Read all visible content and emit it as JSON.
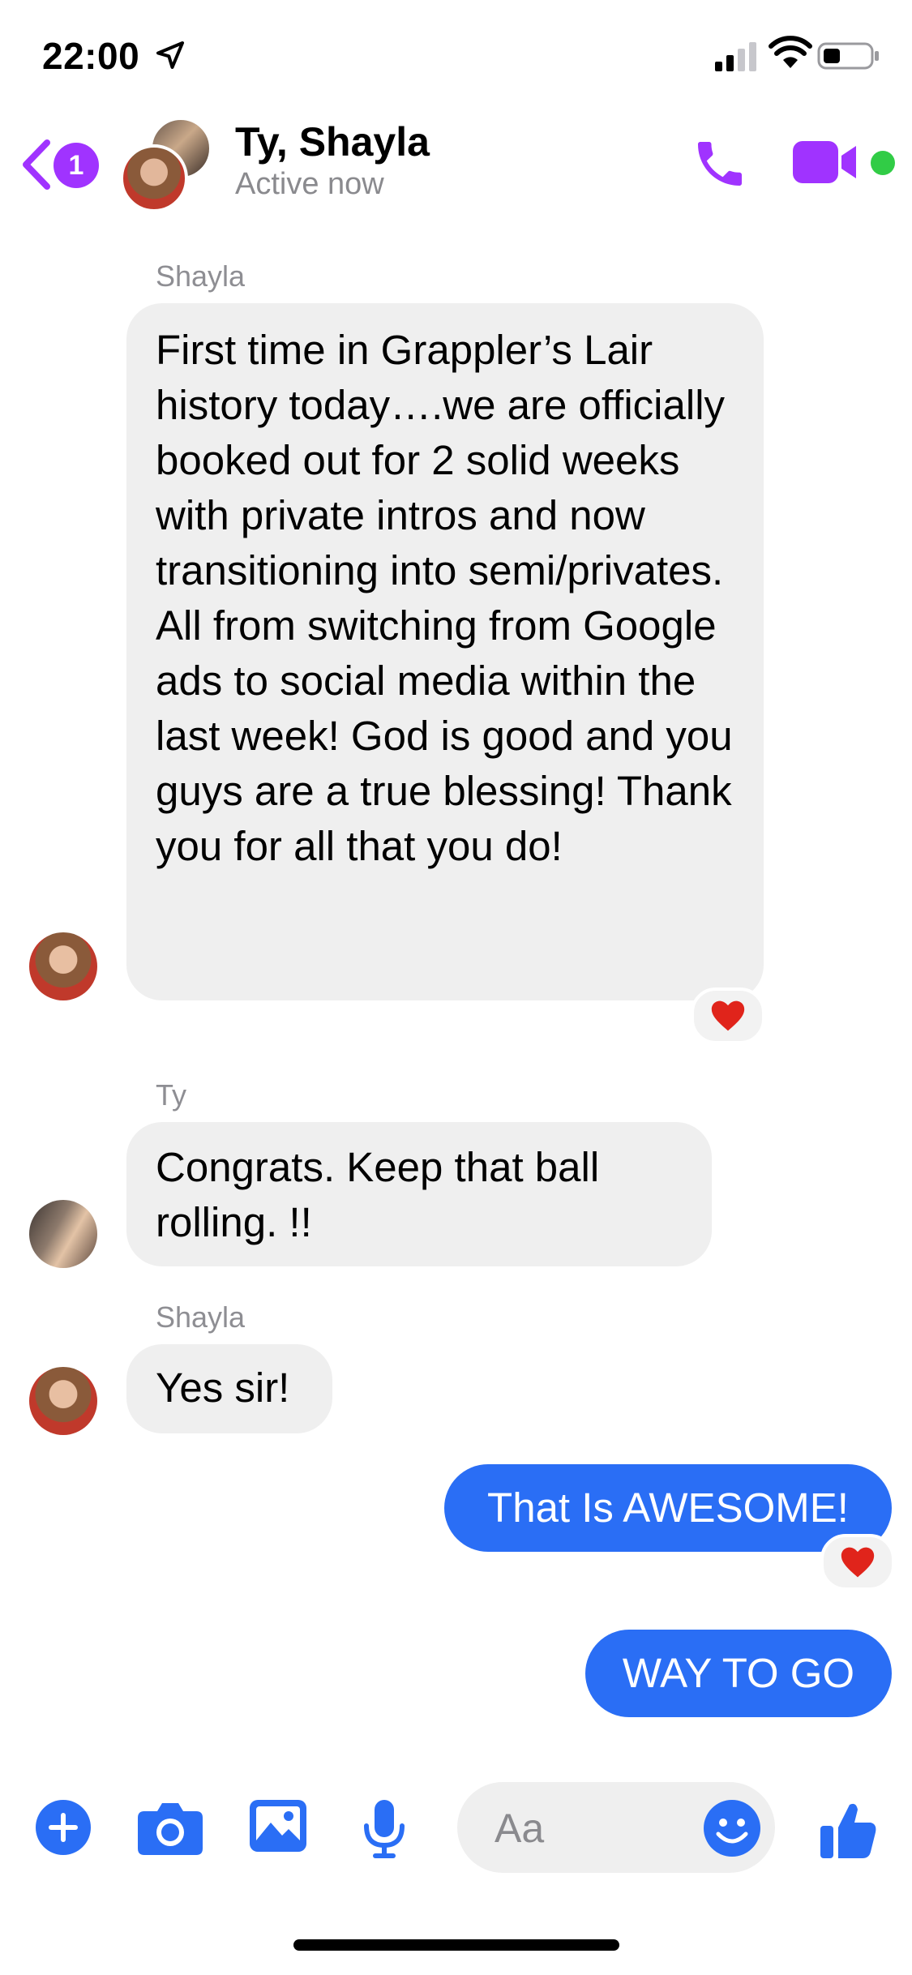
{
  "status_bar": {
    "time": "22:00"
  },
  "header": {
    "back_badge": "1",
    "title": "Ty, Shayla",
    "subtitle": "Active now"
  },
  "messages": [
    {
      "sender": "Shayla",
      "direction": "incoming",
      "text": "First time in Grappler’s Lair history today….we are officially booked out for 2 solid weeks with private intros and now transitioning into semi/privates. All from switching from Google ads to social media within the last week! God is good and you guys are a true blessing! Thank you for all that you do!",
      "reaction": "heart"
    },
    {
      "sender": "Ty",
      "direction": "incoming",
      "text": "Congrats.   Keep that ball rolling. !!"
    },
    {
      "sender": "Shayla",
      "direction": "incoming",
      "text": "Yes sir!"
    },
    {
      "direction": "outgoing",
      "text": "That Is AWESOME!",
      "reaction": "heart"
    },
    {
      "direction": "outgoing",
      "text": "WAY TO GO"
    }
  ],
  "composer": {
    "placeholder": "Aa"
  },
  "colors": {
    "accent": "#a033ff",
    "outgoing_bubble": "#2a6ef5",
    "incoming_bubble": "#efefef",
    "online": "#31cc46",
    "composer_icons": "#2a6ef5",
    "reaction_heart": "#e0241b"
  },
  "icons": [
    "location-arrow-icon",
    "signal-icon",
    "wifi-icon",
    "battery-icon",
    "back-chevron-icon",
    "phone-icon",
    "video-camera-icon",
    "plus-icon",
    "camera-icon",
    "gallery-icon",
    "microphone-icon",
    "emoji-icon",
    "thumbs-up-icon",
    "heart-icon"
  ]
}
